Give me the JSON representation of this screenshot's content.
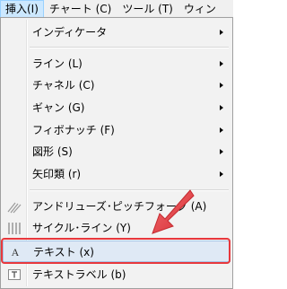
{
  "menubar": {
    "items": [
      {
        "label": "挿入(I)",
        "active": true
      },
      {
        "label": "チャート (C)"
      },
      {
        "label": "ツール (T)"
      },
      {
        "label": "ウィン"
      }
    ]
  },
  "menu": {
    "items": [
      {
        "label": "インディケータ",
        "submenu": true
      },
      {
        "label": "ライン (L)",
        "submenu": true
      },
      {
        "label": "チャネル (C)",
        "submenu": true
      },
      {
        "label": "ギャン (G)",
        "submenu": true
      },
      {
        "label": "フィボナッチ (F)",
        "submenu": true
      },
      {
        "label": "図形 (S)",
        "submenu": true
      },
      {
        "label": "矢印類 (r)",
        "submenu": true
      },
      {
        "label": "アンドリューズ･ピッチフォーク (A)",
        "icon": "pitchfork-icon"
      },
      {
        "label": "サイクル･ライン (Y)",
        "icon": "cycle-lines-icon"
      },
      {
        "label": "テキスト (x)",
        "icon": "text-a-icon",
        "highlighted": true
      },
      {
        "label": "テキストラベル (b)",
        "icon": "text-label-icon"
      }
    ]
  },
  "colors": {
    "highlight_bg": "#dfe9f5",
    "annotation_red": "#e8383d"
  },
  "icon_glyphs": {
    "text_a": "A"
  }
}
